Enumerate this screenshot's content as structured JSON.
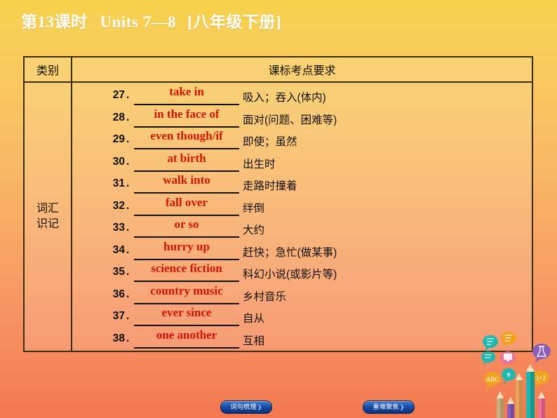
{
  "slide": {
    "title_lesson": "第13课时",
    "title_units": "Units 7—8",
    "title_grade": "[八年级下册]",
    "background_top_color": "#f6d24a",
    "background_bottom_color": "#f4794f"
  },
  "table": {
    "header": {
      "category_label": "类别",
      "requirement_label": "课标考点要求"
    },
    "category_line1": "词汇",
    "category_line2": "识记",
    "answer_color": "#d41400",
    "rows": [
      {
        "num": "27",
        "dot": ".",
        "answer": "take in",
        "meaning": "吸入；吞入(体内)"
      },
      {
        "num": "28",
        "dot": ".",
        "answer": "in the face of",
        "meaning": "面对(问题、困难等)"
      },
      {
        "num": "29",
        "dot": ".",
        "answer": "even though/if",
        "meaning": "即使；虽然"
      },
      {
        "num": "30",
        "dot": ".",
        "answer": "at birth",
        "meaning": "出生时"
      },
      {
        "num": "31",
        "dot": ".",
        "answer": "walk into",
        "meaning": "走路时撞着"
      },
      {
        "num": "32",
        "dot": ".",
        "answer": "fall over",
        "meaning": "绊倒"
      },
      {
        "num": "33",
        "dot": ".",
        "answer": "or so",
        "meaning": "大约"
      },
      {
        "num": "34",
        "dot": ".",
        "answer": "hurry up",
        "meaning": "赶快；急忙(做某事)"
      },
      {
        "num": "35",
        "dot": ".",
        "answer": "science fiction",
        "meaning": "科幻小说(或影片等)"
      },
      {
        "num": "36",
        "dot": ".",
        "answer": "country music",
        "meaning": "乡村音乐"
      },
      {
        "num": "37",
        "dot": ".",
        "answer": "ever since",
        "meaning": "自从"
      },
      {
        "num": "38",
        "dot": ".",
        "answer": "one another",
        "meaning": "互相"
      }
    ]
  },
  "nav": {
    "left_button": "词句梳理",
    "right_button": "重难聚焦",
    "arrow_glyph": "❯",
    "button_color": "#1b4fa8"
  },
  "decoration": {
    "name": "pencils-and-speech-bubbles"
  }
}
